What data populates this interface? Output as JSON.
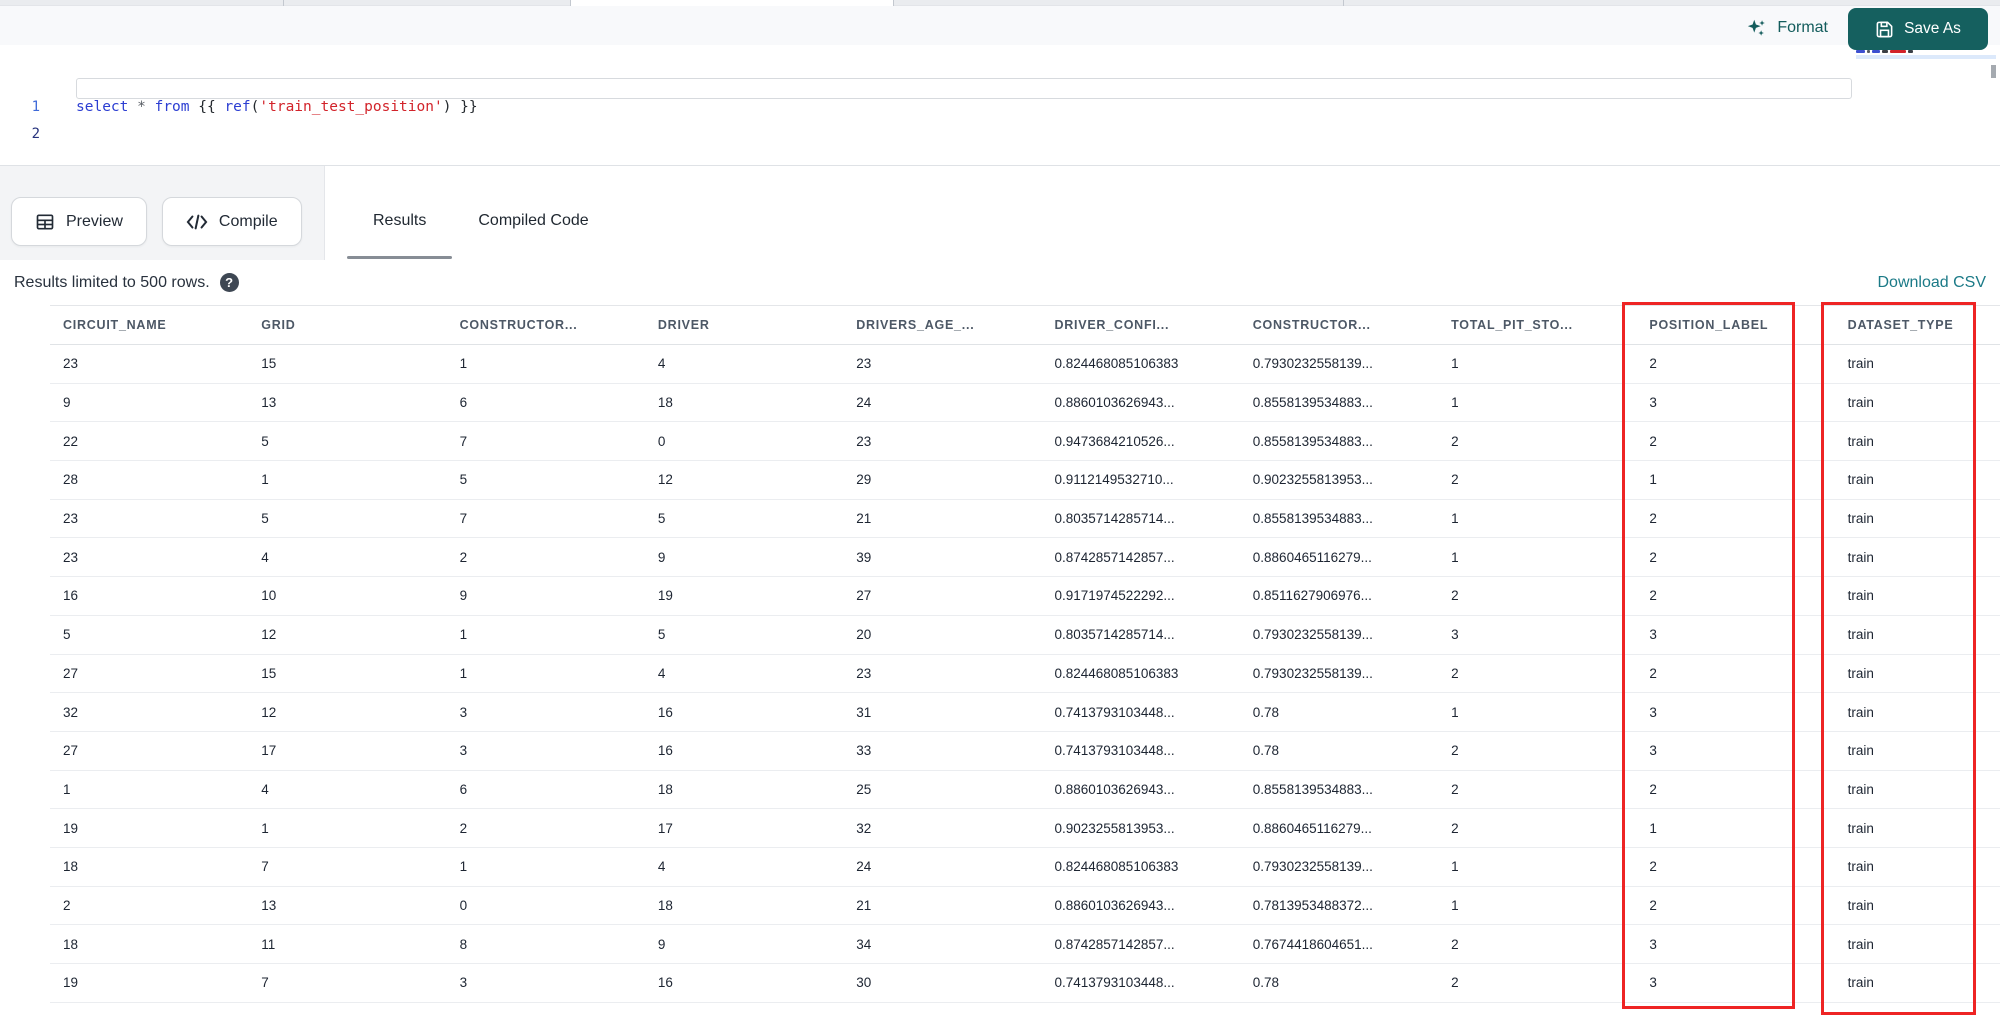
{
  "colors": {
    "teal": "#15605f",
    "teal_link": "#1b7a87",
    "annotation_red": "#ee2424",
    "keyword_blue": "#2c3ed2",
    "string_red": "#d2232a"
  },
  "editor_toolbar": {
    "format_label": "Format",
    "save_as_label": "Save As"
  },
  "editor": {
    "lines": [
      {
        "number": "1"
      },
      {
        "number": "2"
      }
    ],
    "code_tokens": [
      {
        "text": "select",
        "type": "keyword"
      },
      {
        "text": " ",
        "type": "plain"
      },
      {
        "text": "*",
        "type": "operator"
      },
      {
        "text": " ",
        "type": "plain"
      },
      {
        "text": "from",
        "type": "keyword"
      },
      {
        "text": " {{ ",
        "type": "plain"
      },
      {
        "text": "ref",
        "type": "function"
      },
      {
        "text": "(",
        "type": "plain"
      },
      {
        "text": "'train_test_position'",
        "type": "string"
      },
      {
        "text": ") }}",
        "type": "plain"
      }
    ]
  },
  "results_panel": {
    "preview_label": "Preview",
    "compile_label": "Compile",
    "tabs": [
      {
        "label": "Results",
        "active": true
      },
      {
        "label": "Compiled Code",
        "active": false
      }
    ],
    "limit_notice": "Results limited to 500 rows.",
    "help_glyph": "?",
    "download_csv_label": "Download CSV"
  },
  "table": {
    "columns": [
      "CIRCUIT_NAME",
      "GRID",
      "CONSTRUCTOR...",
      "DRIVER",
      "DRIVERS_AGE_...",
      "DRIVER_CONFI...",
      "CONSTRUCTOR...",
      "TOTAL_PIT_STO...",
      "POSITION_LABEL",
      "DATASET_TYPE"
    ],
    "annotated_columns": [
      "POSITION_LABEL",
      "DATASET_TYPE"
    ],
    "rows": [
      [
        "23",
        "15",
        "1",
        "4",
        "23",
        "0.824468085106383",
        "0.7930232558139...",
        "1",
        "2",
        "train"
      ],
      [
        "9",
        "13",
        "6",
        "18",
        "24",
        "0.8860103626943...",
        "0.8558139534883...",
        "1",
        "3",
        "train"
      ],
      [
        "22",
        "5",
        "7",
        "0",
        "23",
        "0.9473684210526...",
        "0.8558139534883...",
        "2",
        "2",
        "train"
      ],
      [
        "28",
        "1",
        "5",
        "12",
        "29",
        "0.9112149532710...",
        "0.9023255813953...",
        "2",
        "1",
        "train"
      ],
      [
        "23",
        "5",
        "7",
        "5",
        "21",
        "0.8035714285714...",
        "0.8558139534883...",
        "1",
        "2",
        "train"
      ],
      [
        "23",
        "4",
        "2",
        "9",
        "39",
        "0.8742857142857...",
        "0.8860465116279...",
        "1",
        "2",
        "train"
      ],
      [
        "16",
        "10",
        "9",
        "19",
        "27",
        "0.9171974522292...",
        "0.8511627906976...",
        "2",
        "2",
        "train"
      ],
      [
        "5",
        "12",
        "1",
        "5",
        "20",
        "0.8035714285714...",
        "0.7930232558139...",
        "3",
        "3",
        "train"
      ],
      [
        "27",
        "15",
        "1",
        "4",
        "23",
        "0.824468085106383",
        "0.7930232558139...",
        "2",
        "2",
        "train"
      ],
      [
        "32",
        "12",
        "3",
        "16",
        "31",
        "0.7413793103448...",
        "0.78",
        "1",
        "3",
        "train"
      ],
      [
        "27",
        "17",
        "3",
        "16",
        "33",
        "0.7413793103448...",
        "0.78",
        "2",
        "3",
        "train"
      ],
      [
        "1",
        "4",
        "6",
        "18",
        "25",
        "0.8860103626943...",
        "0.8558139534883...",
        "2",
        "2",
        "train"
      ],
      [
        "19",
        "1",
        "2",
        "17",
        "32",
        "0.9023255813953...",
        "0.8860465116279...",
        "2",
        "1",
        "train"
      ],
      [
        "18",
        "7",
        "1",
        "4",
        "24",
        "0.824468085106383",
        "0.7930232558139...",
        "1",
        "2",
        "train"
      ],
      [
        "2",
        "13",
        "0",
        "18",
        "21",
        "0.8860103626943...",
        "0.7813953488372...",
        "1",
        "2",
        "train"
      ],
      [
        "18",
        "11",
        "8",
        "9",
        "34",
        "0.8742857142857...",
        "0.7674418604651...",
        "2",
        "3",
        "train"
      ],
      [
        "19",
        "7",
        "3",
        "16",
        "30",
        "0.7413793103448...",
        "0.78",
        "2",
        "3",
        "train"
      ]
    ]
  }
}
